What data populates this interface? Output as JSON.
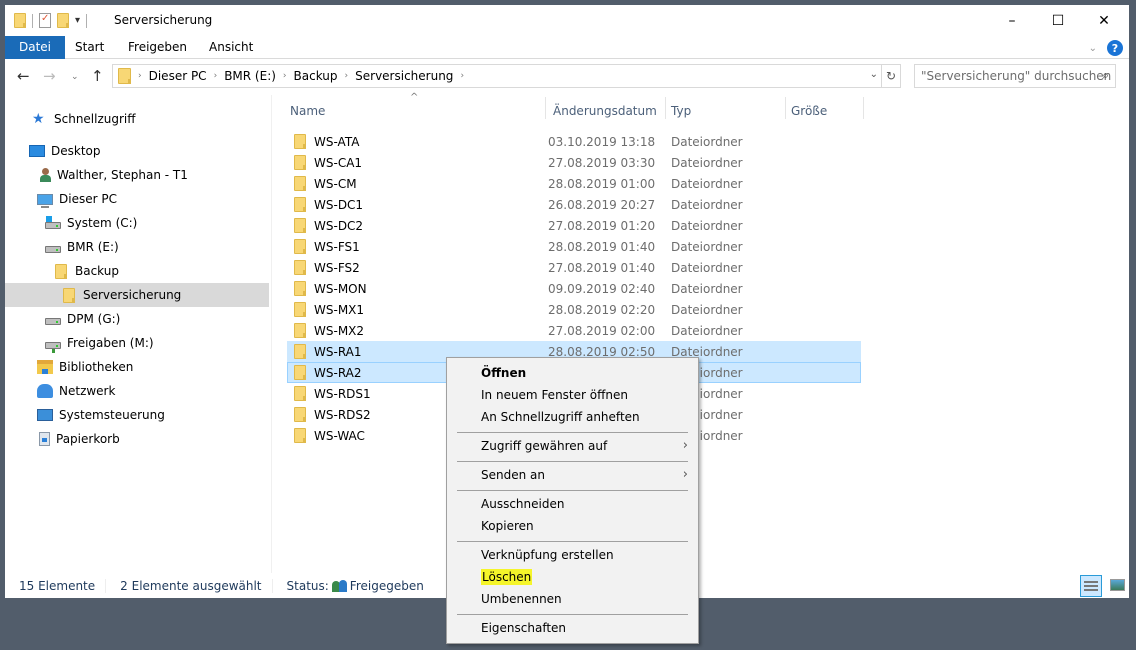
{
  "window": {
    "title": "Serversicherung",
    "controls": {
      "minimize": "–",
      "maximize": "☐",
      "close": "✕"
    }
  },
  "quick_access_toolbar": {
    "icons": [
      "folder-icon",
      "properties-icon",
      "new-folder-icon",
      "customize-dropdown-icon"
    ]
  },
  "ribbon": {
    "tabs": [
      {
        "label": "Datei",
        "active": true
      },
      {
        "label": "Start"
      },
      {
        "label": "Freigeben"
      },
      {
        "label": "Ansicht"
      }
    ],
    "expand_icon": "⌄",
    "help_icon": "?"
  },
  "navigation": {
    "back": "←",
    "forward": "→",
    "recent": "⌄",
    "up": "↑",
    "breadcrumb": [
      "Dieser PC",
      "BMR (E:)",
      "Backup",
      "Serversicherung"
    ],
    "address_dropdown": "⌄",
    "refresh": "↻",
    "search_placeholder": "\"Serversicherung\" durchsuchen",
    "search_icon": "⌕"
  },
  "sidebar": {
    "items": [
      {
        "label": "Schnellzugriff",
        "icon": "star-icon"
      },
      {
        "label": "Desktop",
        "icon": "desktop-icon"
      },
      {
        "label": "Walther, Stephan - T1",
        "icon": "user-icon"
      },
      {
        "label": "Dieser PC",
        "icon": "pc-icon"
      },
      {
        "label": "System (C:)",
        "icon": "system-drive-icon"
      },
      {
        "label": "BMR (E:)",
        "icon": "drive-icon"
      },
      {
        "label": "Backup",
        "icon": "folder-icon"
      },
      {
        "label": "Serversicherung",
        "icon": "folder-icon",
        "selected": true
      },
      {
        "label": "DPM (G:)",
        "icon": "drive-icon"
      },
      {
        "label": "Freigaben (M:)",
        "icon": "network-drive-icon"
      },
      {
        "label": "Bibliotheken",
        "icon": "libraries-icon"
      },
      {
        "label": "Netzwerk",
        "icon": "network-icon"
      },
      {
        "label": "Systemsteuerung",
        "icon": "control-panel-icon"
      },
      {
        "label": "Papierkorb",
        "icon": "recycle-bin-icon"
      }
    ]
  },
  "file_list": {
    "columns": [
      "Name",
      "Änderungsdatum",
      "Typ",
      "Größe"
    ],
    "sort_indicator": "^",
    "rows": [
      {
        "name": "WS-ATA",
        "date": "03.10.2019 13:18",
        "type": "Dateiordner"
      },
      {
        "name": "WS-CA1",
        "date": "27.08.2019 03:30",
        "type": "Dateiordner"
      },
      {
        "name": "WS-CM",
        "date": "28.08.2019 01:00",
        "type": "Dateiordner"
      },
      {
        "name": "WS-DC1",
        "date": "26.08.2019 20:27",
        "type": "Dateiordner"
      },
      {
        "name": "WS-DC2",
        "date": "27.08.2019 01:20",
        "type": "Dateiordner"
      },
      {
        "name": "WS-FS1",
        "date": "28.08.2019 01:40",
        "type": "Dateiordner"
      },
      {
        "name": "WS-FS2",
        "date": "27.08.2019 01:40",
        "type": "Dateiordner"
      },
      {
        "name": "WS-MON",
        "date": "09.09.2019 02:40",
        "type": "Dateiordner"
      },
      {
        "name": "WS-MX1",
        "date": "28.08.2019 02:20",
        "type": "Dateiordner"
      },
      {
        "name": "WS-MX2",
        "date": "27.08.2019 02:00",
        "type": "Dateiordner"
      },
      {
        "name": "WS-RA1",
        "date": "28.08.2019 02:50",
        "type": "Dateiordner",
        "selected": true
      },
      {
        "name": "WS-RA2",
        "date": "",
        "type": "Dateiordner",
        "selected": true,
        "focused": true
      },
      {
        "name": "WS-RDS1",
        "date": "",
        "type": "Dateiordner"
      },
      {
        "name": "WS-RDS2",
        "date": "",
        "type": "Dateiordner"
      },
      {
        "name": "WS-WAC",
        "date": "",
        "type": "Dateiordner"
      }
    ]
  },
  "context_menu": {
    "items": [
      {
        "label": "Öffnen",
        "bold": true
      },
      {
        "label": "In neuem Fenster öffnen"
      },
      {
        "label": "An Schnellzugriff anheften"
      },
      {
        "separator": true
      },
      {
        "label": "Zugriff gewähren auf",
        "submenu": true
      },
      {
        "separator": true
      },
      {
        "label": "Senden an",
        "submenu": true
      },
      {
        "separator": true
      },
      {
        "label": "Ausschneiden"
      },
      {
        "label": "Kopieren"
      },
      {
        "separator": true
      },
      {
        "label": "Verknüpfung erstellen"
      },
      {
        "label": "Löschen",
        "highlighted": true
      },
      {
        "label": "Umbenennen"
      },
      {
        "separator": true
      },
      {
        "label": "Eigenschaften"
      }
    ],
    "submenu_arrow": "›",
    "highlight_color": "#f5f52a"
  },
  "status_bar": {
    "item_count": "15 Elemente",
    "selected_count": "2 Elemente ausgewählt",
    "status_label": "Status:",
    "status_value": "Freigegeben"
  },
  "colors": {
    "accent": "#1a6bb8",
    "selection": "#cce8ff",
    "selection_border": "#99d1ff",
    "desktop_bg": "#525d6b"
  }
}
